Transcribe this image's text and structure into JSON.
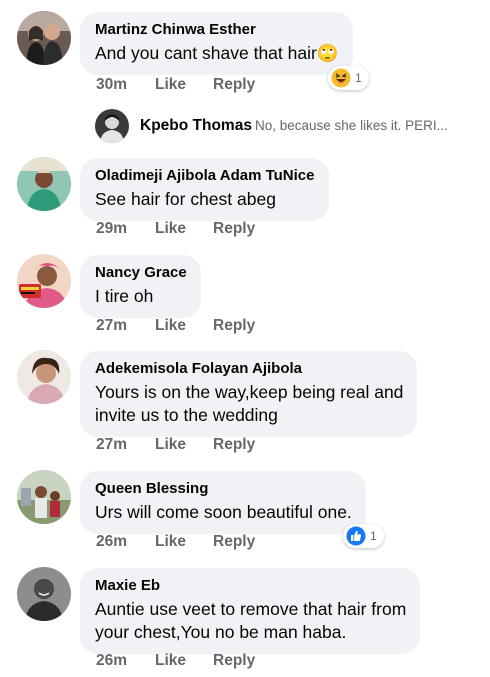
{
  "comments": [
    {
      "author": "Martinz Chinwa Esther",
      "text": "And you cant shave that hair🙄",
      "time": "30m",
      "like": "Like",
      "reply": "Reply",
      "reaction": {
        "icon": "laughing-emoji-icon",
        "count": "1"
      }
    },
    {
      "author": "Oladimeji Ajibola Adam TuNice",
      "text": "See hair for chest abeg",
      "time": "29m",
      "like": "Like",
      "reply": "Reply"
    },
    {
      "author": "Nancy Grace",
      "text": "I tire oh",
      "time": "27m",
      "like": "Like",
      "reply": "Reply"
    },
    {
      "author": "Adekemisola Folayan Ajibola",
      "text_lines": [
        "Yours is on the way,keep being real and",
        "invite us to the wedding"
      ],
      "time": "27m",
      "like": "Like",
      "reply": "Reply"
    },
    {
      "author": "Queen Blessing",
      "text": "Urs will come soon beautiful one.",
      "time": "26m",
      "like": "Like",
      "reply": "Reply",
      "reaction": {
        "icon": "thumbs-up-icon",
        "count": "1"
      }
    },
    {
      "author": "Maxie Eb",
      "text_lines": [
        "Auntie use veet to remove that hair from",
        "your chest,You no be man haba."
      ],
      "time": "26m",
      "like": "Like",
      "reply": "Reply"
    }
  ],
  "reply_preview": {
    "author": "Kpebo Thomas",
    "snippet": "No, because she likes it. PERI..."
  },
  "colors": {
    "bubble": "#f0f2f5",
    "meta": "#65676b",
    "like_blue": "#1877f2",
    "emoji_yellow": "#f7b928"
  }
}
